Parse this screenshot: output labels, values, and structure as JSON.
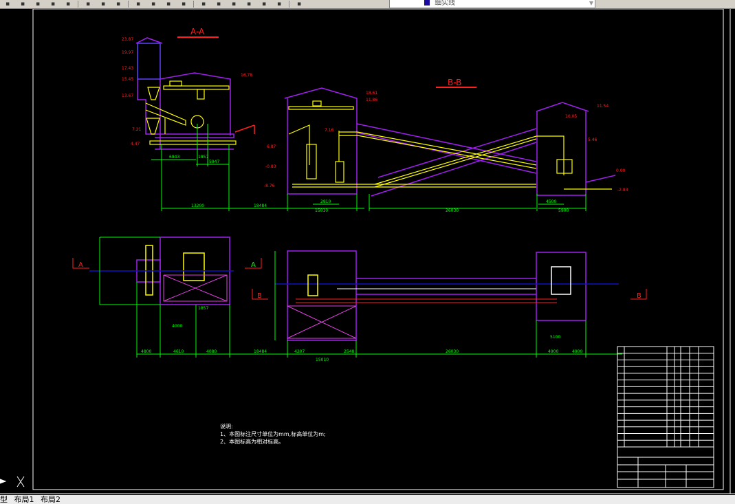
{
  "toolbar": {
    "icons": [
      "print-icon",
      "publish-icon",
      "cut-icon",
      "copy-icon",
      "paste-icon",
      "matchprop-icon",
      "undo-icon",
      "redo-icon",
      "pan-icon",
      "zoom-realtime-icon",
      "zoom-window-icon",
      "zoom-previous-icon",
      "properties-icon",
      "design-center-icon",
      "tool-palettes-icon",
      "sheet-set-icon",
      "markup-icon",
      "calculator-icon",
      "help-icon",
      "layer-manager-icon"
    ],
    "layer_name": "细实线",
    "layer_color": "#1a0aa0"
  },
  "drawing": {
    "section_aa_title": "A-A",
    "section_bb_title": "B-B",
    "cut_labels": {
      "a_left": "A",
      "a_right": "A",
      "b_left": "B",
      "b_right": "B"
    },
    "elevations_aa": [
      "23.87",
      "19.97",
      "17.43",
      "15.45",
      "13.67",
      "7.21",
      "4.47",
      "16.78"
    ],
    "elevations_bb": [
      "18.61",
      "11.86",
      "7.16",
      "6.87",
      "-0.83",
      "-8.76",
      "-2.83",
      "0.00",
      "5.46",
      "11.54",
      "10.05"
    ],
    "dims_aa": [
      "6843",
      "1857",
      "5947",
      "13200",
      "18484"
    ],
    "dims_bb": [
      "2810",
      "15010",
      "26030",
      "4500",
      "5900"
    ],
    "dims_plan": [
      "4800",
      "4610",
      "4080",
      "18484",
      "4207",
      "2548",
      "15010",
      "26030",
      "4900",
      "4900",
      "4000",
      "1857",
      "5100"
    ],
    "notes": {
      "heading": "说明:",
      "items": [
        "1、本图标注尺寸单位为mm,标高单位为m;",
        "2、本图标高为相对标高。"
      ]
    }
  },
  "title_block_rows": 15,
  "colors": {
    "background": "#000000",
    "wall": "#a020f0",
    "equipment": "#ffff00",
    "dimension": "#00ff00",
    "annotation": "#ff0000",
    "axis": "#1010c0"
  },
  "tabs": [
    "型",
    "布局1",
    "布局2"
  ]
}
